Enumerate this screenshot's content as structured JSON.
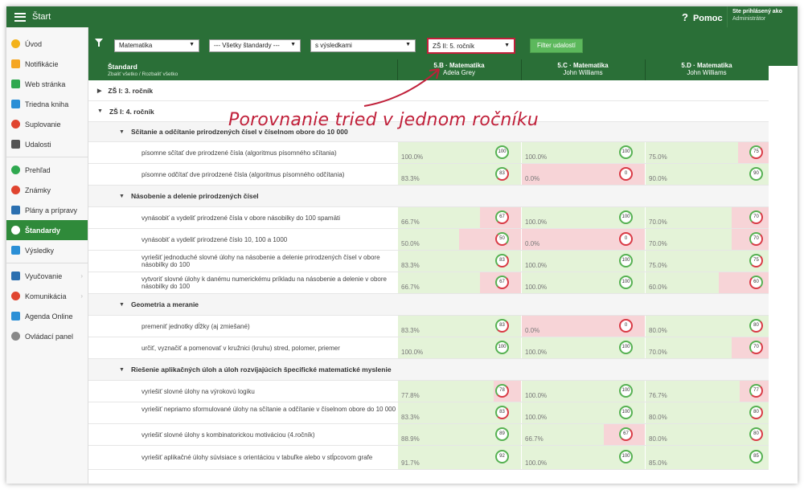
{
  "topbar": {
    "title": "Štart",
    "help": "Pomoc",
    "help_icon": "question-icon",
    "user_line1": "Ste prihlásený ako",
    "user_line2": "Administrátor"
  },
  "sidebar": {
    "items": [
      {
        "label": "Úvod",
        "icon": "star-icon",
        "color": "#f3b21b"
      },
      {
        "label": "Notifikácie",
        "icon": "mail-icon",
        "color": "#f5a623"
      },
      {
        "label": "Web stránka",
        "icon": "home-icon",
        "color": "#2fa84f"
      },
      {
        "label": "Triedna kniha",
        "icon": "book-icon",
        "color": "#2b8fd6"
      },
      {
        "label": "Suplovanie",
        "icon": "substitute-icon",
        "color": "#e0442f"
      },
      {
        "label": "Udalosti",
        "icon": "calendar-icon",
        "color": "#555555"
      },
      {
        "label": "Prehľad",
        "icon": "check-icon",
        "color": "#2fa84f"
      },
      {
        "label": "Známky",
        "icon": "grades-icon",
        "color": "#e0442f"
      },
      {
        "label": "Plány a prípravy",
        "icon": "plans-icon",
        "color": "#2b6fb0"
      },
      {
        "label": "Štandardy",
        "icon": "standards-icon",
        "color": "#ffffff"
      },
      {
        "label": "Výsledky",
        "icon": "results-icon",
        "color": "#2b8fd6"
      },
      {
        "label": "Vyučovanie",
        "icon": "teaching-icon",
        "color": "#2b6fb0"
      },
      {
        "label": "Komunikácia",
        "icon": "communication-icon",
        "color": "#e0442f"
      },
      {
        "label": "Agenda Online",
        "icon": "agenda-icon",
        "color": "#2b8fd6"
      },
      {
        "label": "Ovládací panel",
        "icon": "gear-icon",
        "color": "#888888"
      }
    ]
  },
  "filters": {
    "subject": "Matematika",
    "standards": "--- Všetky štandardy ---",
    "results": "s výsledkami",
    "grade": "ZŠ II: 5. ročník",
    "button": "Filter udalostí"
  },
  "table": {
    "header_std": "Štandard",
    "header_sub": "Zbaliť všetko / Rozbaliť všetko",
    "columns": [
      {
        "cls": "5.B · Matematika",
        "teacher": "Adela Grey"
      },
      {
        "cls": "5.C · Matematika",
        "teacher": "John Williams"
      },
      {
        "cls": "5.D · Matematika",
        "teacher": "John Williams"
      }
    ],
    "groups": {
      "g1": "ZŠ I: 3. ročník",
      "g2": "ZŠ I: 4. ročník",
      "s1": "Sčítanie a odčítanie prirodzených čísel v číselnom obore do 10 000",
      "s2": "Násobenie a delenie prirodzených čísel",
      "s3": "Geometria a meranie",
      "s4": "Riešenie aplikačných úloh a úloh rozvíjajúcich špecifické matematické myslenie"
    },
    "rows": [
      {
        "desc": "písomne sčítať dve prirodzené čísla (algoritmus písomného sčítania)",
        "vals": [
          "100.0%",
          "100.0%",
          "75.0%"
        ],
        "badges": [
          "100",
          "100",
          "75"
        ]
      },
      {
        "desc": "písomne odčítať dve prirodzené čísla (algoritmus písomného odčítania)",
        "vals": [
          "83.3%",
          "0.0%",
          "90.0%"
        ],
        "badges": [
          "83",
          "0",
          "90"
        ]
      },
      {
        "desc": "vynásobiť a vydeliť prirodzené čísla v obore násobilky do 100 spamäti",
        "vals": [
          "66.7%",
          "100.0%",
          "70.0%"
        ],
        "badges": [
          "67",
          "100",
          "70"
        ]
      },
      {
        "desc": "vynásobiť a vydeliť prirodzené číslo 10, 100 a 1000",
        "vals": [
          "50.0%",
          "0.0%",
          "70.0%"
        ],
        "badges": [
          "50",
          "0",
          "70"
        ]
      },
      {
        "desc": "vyriešiť jednoduché slovné úlohy na násobenie a delenie prirodzených čísel v obore násobilky do 100",
        "vals": [
          "83.3%",
          "100.0%",
          "75.0%"
        ],
        "badges": [
          "83",
          "100",
          "75"
        ]
      },
      {
        "desc": "vytvoriť slovné úlohy k danému numerickému príkladu na násobenie a delenie v obore násobilky do 100",
        "vals": [
          "66.7%",
          "100.0%",
          "60.0%"
        ],
        "badges": [
          "67",
          "100",
          "60"
        ]
      },
      {
        "desc": "premeniť jednotky dĺžky (aj zmiešané)",
        "vals": [
          "83.3%",
          "0.0%",
          "80.0%"
        ],
        "badges": [
          "83",
          "0",
          "80"
        ]
      },
      {
        "desc": "určiť, vyznačiť a pomenovať v kružnici (kruhu) stred, polomer, priemer",
        "vals": [
          "100.0%",
          "100.0%",
          "70.0%"
        ],
        "badges": [
          "100",
          "100",
          "70"
        ]
      },
      {
        "desc": "vyriešiť slovné úlohy na výrokovú logiku",
        "vals": [
          "77.8%",
          "100.0%",
          "76.7%"
        ],
        "badges": [
          "78",
          "100",
          "77"
        ]
      },
      {
        "desc": "vyriešiť nepriamo sformulované úlohy na sčítanie a odčítanie v číselnom obore do 10 000",
        "vals": [
          "83.3%",
          "100.0%",
          "80.0%"
        ],
        "badges": [
          "83",
          "100",
          "80"
        ]
      },
      {
        "desc": "vyriešiť slovné úlohy s kombinatorickou motiváciou (4.ročník)",
        "vals": [
          "88.9%",
          "66.7%",
          "80.0%"
        ],
        "badges": [
          "89",
          "67",
          "80"
        ]
      },
      {
        "desc": "vyriešiť aplikačné úlohy súvisiace s orientáciou v tabuľke alebo v stĺpcovom grafe",
        "vals": [
          "91.7%",
          "100.0%",
          "85.0%"
        ],
        "badges": [
          "92",
          "100",
          "85"
        ]
      }
    ]
  },
  "annotation": "Porovnanie tried v jednom ročníku"
}
